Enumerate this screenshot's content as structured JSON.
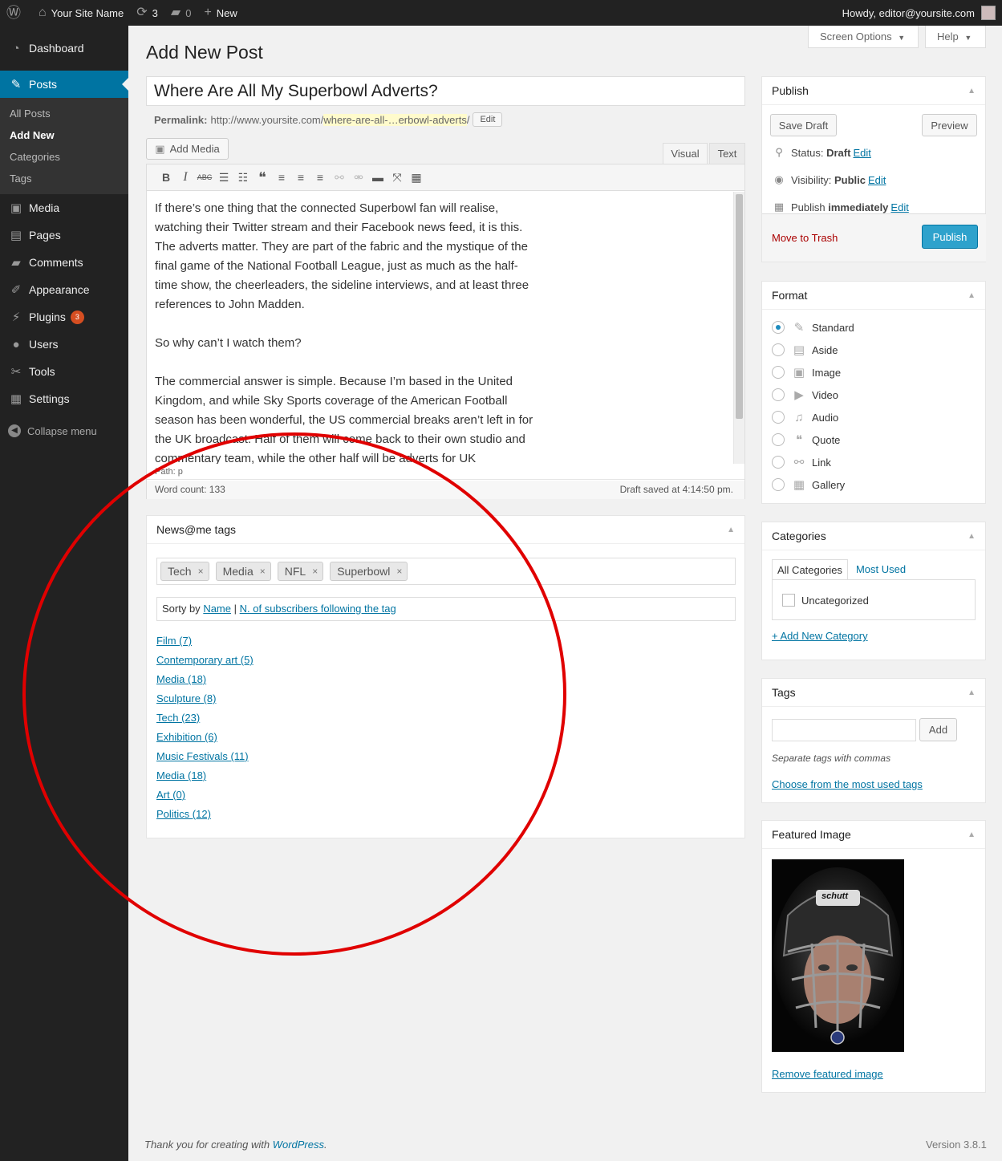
{
  "admin_bar": {
    "site_name": "Your Site Name",
    "updates_count": "3",
    "comments_count": "0",
    "new_label": "New",
    "howdy": "Howdy, editor@yoursite.com"
  },
  "sidebar": {
    "dashboard": "Dashboard",
    "posts": "Posts",
    "posts_sub": {
      "all_posts": "All Posts",
      "add_new": "Add New",
      "categories": "Categories",
      "tags": "Tags"
    },
    "media": "Media",
    "pages": "Pages",
    "comments": "Comments",
    "appearance": "Appearance",
    "plugins": "Plugins",
    "plugins_badge": "3",
    "users": "Users",
    "tools": "Tools",
    "settings": "Settings",
    "collapse": "Collapse menu"
  },
  "top_buttons": {
    "screen_options": "Screen Options",
    "help": "Help"
  },
  "page_title": "Add New Post",
  "post": {
    "title": "Where Are All My Superbowl Adverts?",
    "permalink_label": "Permalink:",
    "permalink_base": "http://www.yoursite.com/",
    "permalink_slug": "where-are-all-…erbowl-adverts",
    "permalink_end": "/",
    "permalink_edit": "Edit"
  },
  "editor": {
    "add_media": "Add Media",
    "tab_visual": "Visual",
    "tab_text": "Text",
    "paragraphs": [
      "If there’s one thing that the connected Superbowl fan will realise, watching their Twitter stream and their Facebook news feed, it is this. The adverts matter. They are part of the fabric and the mystique of the final game of the National Football League, just as much as the half-time show, the cheerleaders, the sideline interviews, and at least three references to John Madden.",
      "So why can’t I watch them?",
      "The commercial answer is simple. Because I’m based in the United Kingdom, and while Sky Sports coverage of the American Football season has been wonderful, the US commercial breaks aren’t left in for the UK broadcast. Half of them will come back to their own studio and commentary team, while the other half will be adverts for UK"
    ],
    "path": "Path: p",
    "word_count": "Word count: 133",
    "draft_saved": "Draft saved at 4:14:50 pm."
  },
  "newsatme": {
    "title": "News@me tags",
    "selected_tags": [
      "Tech",
      "Media",
      "NFL",
      "Superbowl"
    ],
    "sort_prefix": "Sorty by",
    "sort_name": "Name",
    "sort_sep": "|",
    "sort_subs": "N. of subscribers following the tag",
    "tag_list": [
      "Film (7)",
      "Contemporary art (5)",
      "Media (18)",
      "Sculpture (8)",
      "Tech (23)",
      "Exhibition (6)",
      "Music Festivals (11)",
      "Media (18)",
      "Art (0)",
      "Politics (12)"
    ]
  },
  "publish": {
    "title": "Publish",
    "save_draft": "Save Draft",
    "preview": "Preview",
    "status_label": "Status:",
    "status_value": "Draft",
    "visibility_label": "Visibility:",
    "visibility_value": "Public",
    "publish_label": "Publish",
    "publish_value": "immediately",
    "edit": "Edit",
    "trash": "Move to Trash",
    "publish_button": "Publish"
  },
  "format": {
    "title": "Format",
    "options": [
      "Standard",
      "Aside",
      "Image",
      "Video",
      "Audio",
      "Quote",
      "Link",
      "Gallery"
    ],
    "selected": "Standard"
  },
  "categories": {
    "title": "Categories",
    "tab_all": "All Categories",
    "tab_most_used": "Most Used",
    "items": [
      "Uncategorized"
    ],
    "add_new": "+ Add New Category"
  },
  "tags": {
    "title": "Tags",
    "input_value": "",
    "add_button": "Add",
    "hint": "Separate tags with commas",
    "choose": "Choose from the most used tags"
  },
  "featured_image": {
    "title": "Featured Image",
    "remove": "Remove featured image",
    "helmet_text": "schutt"
  },
  "footer": {
    "thanks_prefix": "Thank you for creating with ",
    "wordpress": "WordPress",
    "thanks_suffix": ".",
    "version": "Version 3.8.1"
  },
  "colors": {
    "admin_bg": "#222222",
    "accent": "#0074a2",
    "publish_button": "#2ea2cc",
    "annotation_circle": "#e00000"
  }
}
